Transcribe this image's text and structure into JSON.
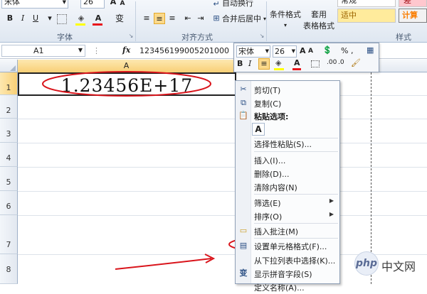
{
  "ribbon": {
    "font_name": "宋体",
    "font_size": "26",
    "grow_font": "A",
    "shrink_font": "A",
    "bold": "B",
    "italic": "I",
    "underline": "U",
    "phonetic": "变",
    "font_color": "A",
    "wrap_text": "自动换行",
    "merge_center": "合并后居中",
    "conditional_format": "条件格式",
    "table_format_line1": "套用",
    "table_format_line2": "表格格式",
    "style_normal": "常规",
    "style_bad": "差",
    "style_neutral": "适中",
    "style_calc": "计算",
    "group_font": "字体",
    "group_alignment": "对齐方式",
    "group_styles": "样式"
  },
  "formula_bar": {
    "name_box": "A1",
    "fx": "fx",
    "content": "123456199005201000"
  },
  "columns": {
    "a": "A"
  },
  "rows": [
    "1",
    "2",
    "3",
    "4",
    "5",
    "6",
    "7",
    "8"
  ],
  "cell_a1": "1.23456E+17",
  "mini_toolbar": {
    "font_name": "宋体",
    "font_size": "26",
    "grow_font": "A",
    "shrink_font": "A",
    "bold": "B",
    "italic": "I",
    "font_color": "A"
  },
  "context_menu": {
    "cut": "剪切(T)",
    "copy": "复制(C)",
    "paste_options": "粘贴选项:",
    "paste_a": "A",
    "paste_special": "选择性粘贴(S)...",
    "insert": "插入(I)...",
    "delete": "删除(D)...",
    "clear": "清除内容(N)",
    "filter": "筛选(E)",
    "sort": "排序(O)",
    "insert_comment": "插入批注(M)",
    "format_cells": "设置单元格格式(F)...",
    "pick_list": "从下拉列表中选择(K)...",
    "phonetic": "显示拼音字段(S)",
    "define_name": "定义名称(A)..."
  },
  "watermark": {
    "php": "php",
    "cn": "中文网"
  },
  "colors": {
    "annotation": "#d9141b",
    "ribbon_selected": "#fbd98b",
    "style_neutral_bg": "#ffeb9c",
    "style_calc_bg": "#f2f2f2",
    "style_calc_fg": "#fa7d00",
    "style_bad_bg": "#ffc7ce"
  }
}
